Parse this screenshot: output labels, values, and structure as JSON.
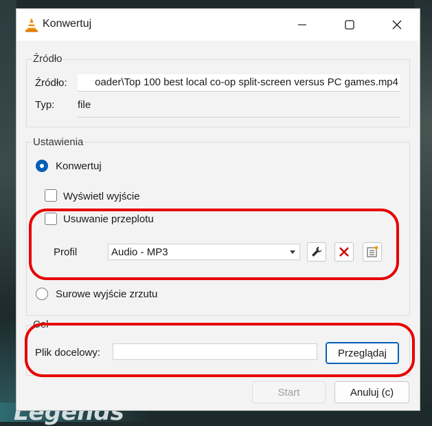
{
  "background": {
    "caption": "Legends"
  },
  "window": {
    "title": "Konwertuj",
    "controls": [
      "minimize-icon",
      "maximize-icon",
      "close-icon"
    ]
  },
  "source_group": {
    "label": "Źródło",
    "source_label": "Źródło:",
    "source_value": "oader\\Top 100 best local co-op split-screen versus PC games.mp4",
    "type_label": "Typ:",
    "type_value": "file"
  },
  "settings_group": {
    "label": "Ustawienia",
    "convert_radio": {
      "label": "Konwertuj",
      "selected": true
    },
    "show_output_check": {
      "label": "Wyświetl wyjście",
      "checked": false
    },
    "deinterlace_check": {
      "label": "Usuwanie przeplotu",
      "checked": false
    },
    "profile_label": "Profil",
    "profile_value": "Audio - MP3",
    "profile_buttons": [
      "wrench-icon",
      "delete-icon",
      "new-profile-icon"
    ],
    "raw_dump_radio": {
      "label": "Surowe wyjście zrzutu",
      "selected": false
    }
  },
  "destination_group": {
    "label": "Cel",
    "file_label": "Plik docelowy:",
    "file_value": "",
    "browse_button": "Przeglądaj"
  },
  "footer": {
    "start_button": "Start",
    "cancel_button": "Anuluj (c)"
  },
  "colors": {
    "accent": "#005fb8",
    "annotation": "#e60000",
    "delete_icon": "#d40000"
  }
}
